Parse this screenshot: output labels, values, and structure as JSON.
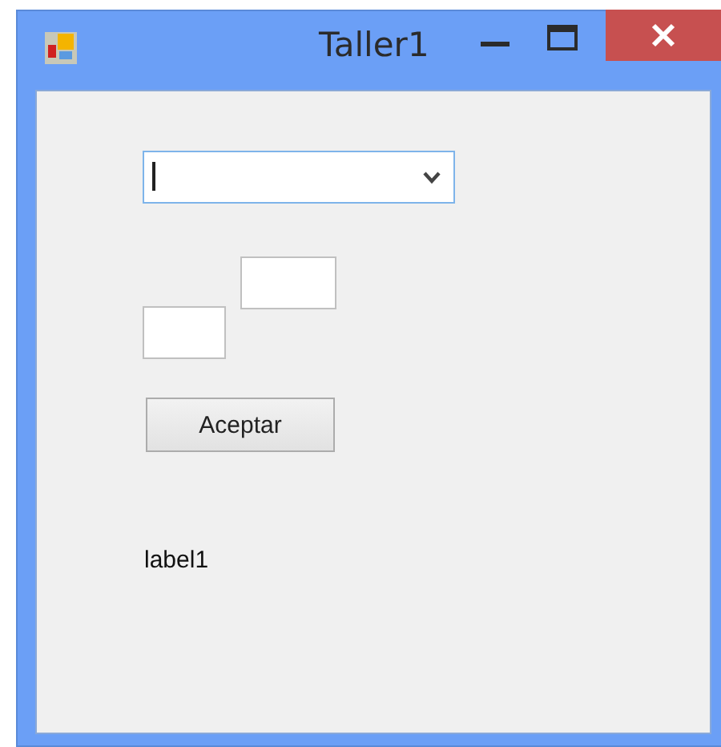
{
  "window": {
    "title": "Taller1"
  },
  "controls": [
    {
      "kind": "combobox",
      "focused": true
    },
    {
      "kind": "textbox"
    },
    {
      "kind": "textbox"
    },
    {
      "kind": "button",
      "label": "Aceptar"
    },
    {
      "kind": "label",
      "text": "label1"
    }
  ]
}
